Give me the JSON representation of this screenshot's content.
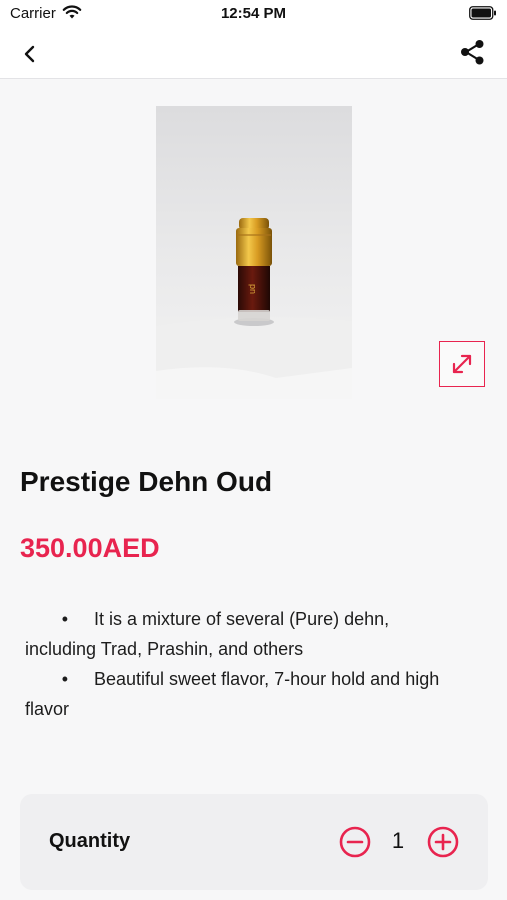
{
  "status_bar": {
    "carrier": "Carrier",
    "time": "12:54 PM"
  },
  "nav": {
    "back_icon": "chevron-left-icon",
    "share_icon": "share-icon"
  },
  "product": {
    "image_description": "Perfume oil bottle with gold cap",
    "title": "Prestige Dehn Oud",
    "price": "350.00AED",
    "description": {
      "bullet_1_line_1": "It is a mixture of several (Pure) dehn,",
      "bullet_1_line_2": "including Trad, Prashin, and others",
      "bullet_2_line_1": "Beautiful sweet flavor, 7-hour hold and high",
      "bullet_2_line_2": "flavor"
    }
  },
  "quantity": {
    "label": "Quantity",
    "value": "1"
  },
  "colors": {
    "accent": "#e8244f",
    "background": "#f7f7f8",
    "card": "#efeff1"
  }
}
